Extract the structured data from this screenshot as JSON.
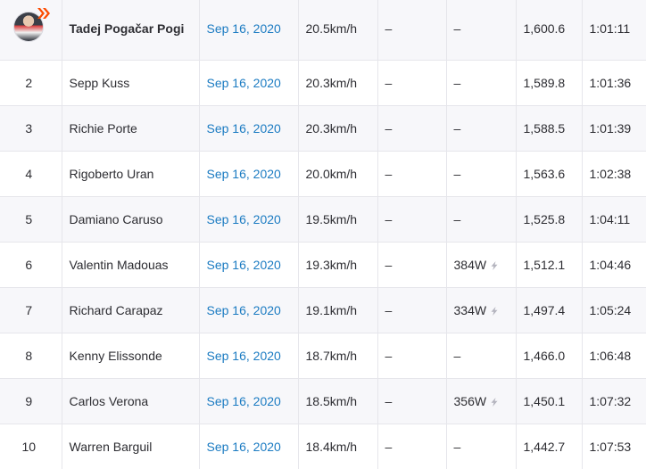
{
  "leaderboard": {
    "rows": [
      {
        "rank": "",
        "name": "Tadej Pogačar Pogi",
        "date": "Sep 16, 2020",
        "speed": "20.5km/h",
        "hr": "–",
        "power": "–",
        "vam": "1,600.6",
        "time": "1:01:11",
        "has_avatar": true,
        "bold": true,
        "power_icon": ""
      },
      {
        "rank": "2",
        "name": "Sepp Kuss",
        "date": "Sep 16, 2020",
        "speed": "20.3km/h",
        "hr": "–",
        "power": "–",
        "vam": "1,589.8",
        "time": "1:01:36",
        "has_avatar": false,
        "bold": false,
        "power_icon": ""
      },
      {
        "rank": "3",
        "name": "Richie Porte",
        "date": "Sep 16, 2020",
        "speed": "20.3km/h",
        "hr": "–",
        "power": "–",
        "vam": "1,588.5",
        "time": "1:01:39",
        "has_avatar": false,
        "bold": false,
        "power_icon": ""
      },
      {
        "rank": "4",
        "name": "Rigoberto Uran",
        "date": "Sep 16, 2020",
        "speed": "20.0km/h",
        "hr": "–",
        "power": "–",
        "vam": "1,563.6",
        "time": "1:02:38",
        "has_avatar": false,
        "bold": false,
        "power_icon": ""
      },
      {
        "rank": "5",
        "name": "Damiano Caruso",
        "date": "Sep 16, 2020",
        "speed": "19.5km/h",
        "hr": "–",
        "power": "–",
        "vam": "1,525.8",
        "time": "1:04:11",
        "has_avatar": false,
        "bold": false,
        "power_icon": ""
      },
      {
        "rank": "6",
        "name": "Valentin Madouas",
        "date": "Sep 16, 2020",
        "speed": "19.3km/h",
        "hr": "–",
        "power": "384W",
        "vam": "1,512.1",
        "time": "1:04:46",
        "has_avatar": false,
        "bold": false,
        "power_icon": "lightning-bolt-icon"
      },
      {
        "rank": "7",
        "name": "Richard Carapaz",
        "date": "Sep 16, 2020",
        "speed": "19.1km/h",
        "hr": "–",
        "power": "334W",
        "vam": "1,497.4",
        "time": "1:05:24",
        "has_avatar": false,
        "bold": false,
        "power_icon": "lightning-bolt-icon"
      },
      {
        "rank": "8",
        "name": "Kenny Elissonde",
        "date": "Sep 16, 2020",
        "speed": "18.7km/h",
        "hr": "–",
        "power": "–",
        "vam": "1,466.0",
        "time": "1:06:48",
        "has_avatar": false,
        "bold": false,
        "power_icon": ""
      },
      {
        "rank": "9",
        "name": "Carlos Verona",
        "date": "Sep 16, 2020",
        "speed": "18.5km/h",
        "hr": "–",
        "power": "356W",
        "vam": "1,450.1",
        "time": "1:07:32",
        "has_avatar": false,
        "bold": false,
        "power_icon": "lightning-bolt-icon"
      },
      {
        "rank": "10",
        "name": "Warren Barguil",
        "date": "Sep 16, 2020",
        "speed": "18.4km/h",
        "hr": "–",
        "power": "–",
        "vam": "1,442.7",
        "time": "1:07:53",
        "has_avatar": false,
        "bold": false,
        "power_icon": ""
      }
    ]
  },
  "colors": {
    "link": "#1b7bc2",
    "text": "#2d2d32",
    "row_alt": "#f7f7fa",
    "border": "#e6e6eb",
    "badge": "#fc4c02",
    "bolt": "#b4b4be"
  }
}
